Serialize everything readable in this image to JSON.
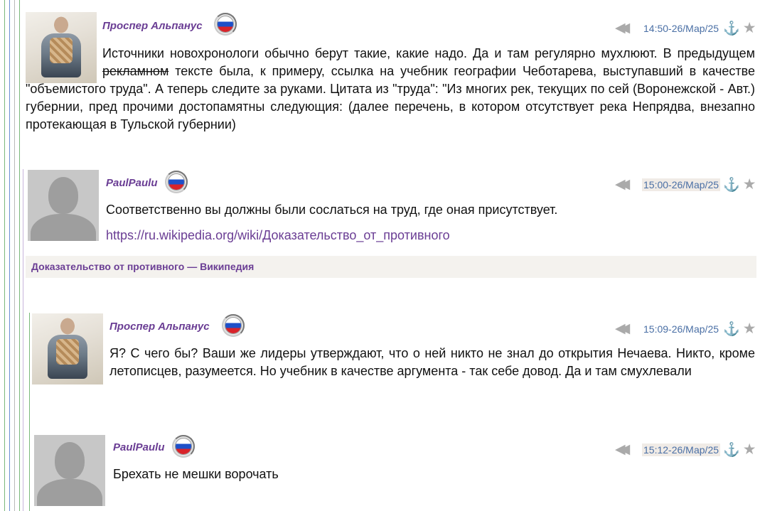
{
  "thread": [
    {
      "author": "Проспер Альпанус",
      "avatar": "user-photo-avatar",
      "flag": "russia-flag-icon",
      "timestamp": "14:50-26/Мар/25",
      "text_before": "Источники новохронологи обычно берут такие, какие надо. Да и там регулярно мухлюют. В пре­дыдущем ",
      "text_strike": "рекламном",
      "text_after": " тексте была, к примеру, ссылка на учебник географии Чеботарева, высту­павший в качестве \"объемистого труда\". А теперь следите за руками. Цитата из \"труда\": \"Из многих рек, текущих по сей (Воронежской - Авт.) губернии, пред прочими достопамятны следующия: (далее перечень, в котором отсутствует река Непрядва, внезапно протекающая в Тульской губернии)"
    },
    {
      "author": "PaulPaulu",
      "avatar": "default-avatar",
      "flag": "russia-flag-icon",
      "timestamp": "15:00-26/Мар/25",
      "text": "Соответственно вы должны были сослаться на труд, где оная присутствует.",
      "link": "https://ru.wikipedia.org/wiki/Доказательство_от_противного",
      "preview_title": "Доказательство от противного — Википедия"
    },
    {
      "author": "Проспер Альпанус",
      "avatar": "user-photo-avatar",
      "flag": "russia-flag-icon",
      "timestamp": "15:09-26/Мар/25",
      "text": "Я? С чего бы? Ваши же лидеры утверждают, что о ней никто не знал до открытия Нечаева. Ни­кто, кроме летописцев, разумеется. Но учебник в качестве аргумента - так себе довод. Да и там смухлевали"
    },
    {
      "author": "PaulPaulu",
      "avatar": "default-avatar",
      "flag": "russia-flag-icon",
      "timestamp": "15:12-26/Мар/25",
      "text": "Брехать не мешки ворочать"
    }
  ],
  "icons": {
    "rewind": "◀◀",
    "anchor": "⚓",
    "star": "★"
  },
  "colors": {
    "author": "#6a3d94",
    "timestamp": "#4a6fa5",
    "timestamp_highlight": "#f0ebe6",
    "preview_bg": "#f4f2ee"
  }
}
